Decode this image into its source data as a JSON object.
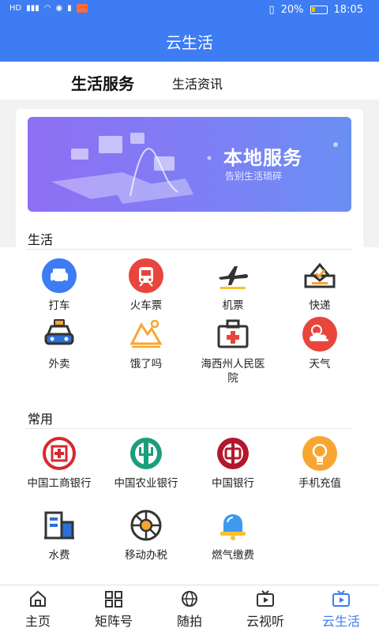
{
  "status_bar": {
    "left_text": "HD",
    "battery_percent": "20%",
    "time": "18:05"
  },
  "header": {
    "title": "云生活"
  },
  "tabs": [
    {
      "label": "生活服务"
    },
    {
      "label": "生活资讯"
    }
  ],
  "banner": {
    "title": "本地服务",
    "subtitle": "告别生活琐碎"
  },
  "sections": {
    "life": {
      "title": "生活",
      "items": [
        {
          "label": "打车",
          "icon": "taxi-icon"
        },
        {
          "label": "火车票",
          "icon": "train-icon"
        },
        {
          "label": "机票",
          "icon": "plane-icon"
        },
        {
          "label": "快递",
          "icon": "express-box-icon"
        },
        {
          "label": "外卖",
          "icon": "delivery-car-icon"
        },
        {
          "label": "饿了吗",
          "icon": "mountain-icon"
        },
        {
          "label": "海西州人民医院",
          "icon": "hospital-icon"
        },
        {
          "label": "天气",
          "icon": "weather-icon"
        }
      ]
    },
    "common": {
      "title": "常用",
      "items": [
        {
          "label": "中国工商银行",
          "icon": "icbc-icon"
        },
        {
          "label": "中国农业银行",
          "icon": "abc-icon"
        },
        {
          "label": "中国银行",
          "icon": "boc-icon"
        },
        {
          "label": "手机充值",
          "icon": "lightbulb-icon"
        },
        {
          "label": "水费",
          "icon": "water-building-icon"
        },
        {
          "label": "移动办税",
          "icon": "tax-wheel-icon"
        },
        {
          "label": "燃气缴费",
          "icon": "gas-bell-icon"
        }
      ]
    }
  },
  "bottom_nav": [
    {
      "label": "主页",
      "icon": "home-icon"
    },
    {
      "label": "矩阵号",
      "icon": "grid-icon"
    },
    {
      "label": "随拍",
      "icon": "globe-icon"
    },
    {
      "label": "云视听",
      "icon": "tv-icon"
    },
    {
      "label": "云生活",
      "icon": "cloud-life-icon",
      "active": true
    }
  ],
  "colors": {
    "primary": "#3d7cf2",
    "red": "#e8453c",
    "green": "#1b9e7e",
    "orange": "#f7a631"
  }
}
